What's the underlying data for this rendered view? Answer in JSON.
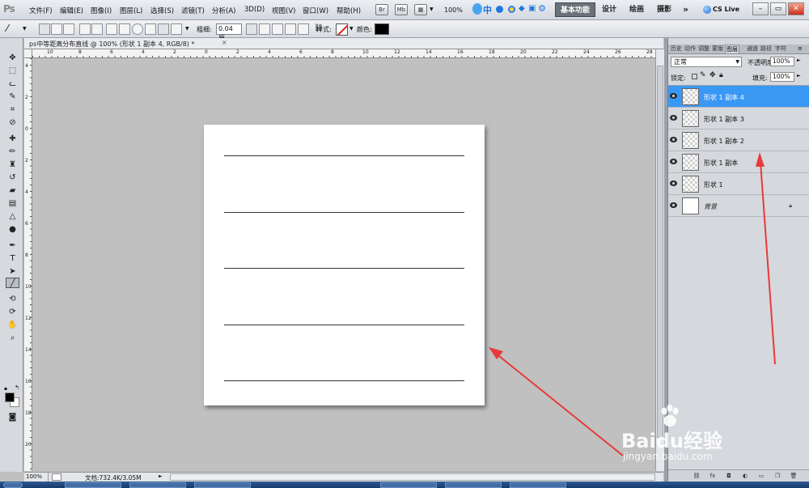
{
  "app": {
    "logo": "Ps"
  },
  "menu": [
    "文件(F)",
    "编辑(E)",
    "图像(I)",
    "图层(L)",
    "选择(S)",
    "滤镜(T)",
    "分析(A)",
    "3D(D)",
    "视图(V)",
    "窗口(W)",
    "帮助(H)"
  ],
  "topbar": {
    "br_label": "Br",
    "mb_label": "Mb",
    "zoom": "100%",
    "ime_char": "中"
  },
  "workspaces": {
    "active": "基本功能",
    "design": "设计",
    "painting": "绘画",
    "photography": "摄影",
    "more": "»",
    "cs_live": "CS Live"
  },
  "options": {
    "weight_label": "粗细:",
    "weight_value": "0.04 厘",
    "style_label": "样式:",
    "color_label": "颜色:",
    "color_value": "#000000"
  },
  "document": {
    "title": "ps中等距离分布直线 @ 100% (形状 1 副本 4, RGB/8) *",
    "close": "×",
    "ruler_h": [
      "10",
      "8",
      "6",
      "4",
      "2",
      "0",
      "2",
      "4",
      "6",
      "8",
      "10",
      "12",
      "14",
      "16",
      "18",
      "20",
      "22",
      "24",
      "26",
      "28"
    ],
    "ruler_v": [
      "4",
      "2",
      "0",
      "2",
      "4",
      "6",
      "8",
      "10",
      "12",
      "14",
      "16",
      "18",
      "20",
      "22"
    ]
  },
  "status": {
    "zoom": "100%",
    "doc_info": "文档:732.4K/3.05M"
  },
  "layers_panel": {
    "tabs": [
      "历史",
      "动作",
      "调整",
      "蒙版",
      "图层",
      "通道",
      "路径",
      "字符"
    ],
    "active_tab": "图层",
    "blend_mode": "正常",
    "opacity_label": "不透明度:",
    "opacity_value": "100%",
    "lock_label": "锁定:",
    "fill_label": "填充:",
    "fill_value": "100%",
    "layers": [
      {
        "name": "形状 1 副本 4",
        "selected": true
      },
      {
        "name": "形状 1 副本 3",
        "selected": false
      },
      {
        "name": "形状 1 副本 2",
        "selected": false
      },
      {
        "name": "形状 1 副本",
        "selected": false
      },
      {
        "name": "形状 1",
        "selected": false
      },
      {
        "name": "背景",
        "selected": false,
        "locked": true
      }
    ]
  },
  "colors": {
    "selection": "#3a98f5",
    "arrow": "#e83a3a"
  },
  "watermark": {
    "main": "Baidu经验",
    "sub": "jingyan.baidu.com"
  }
}
